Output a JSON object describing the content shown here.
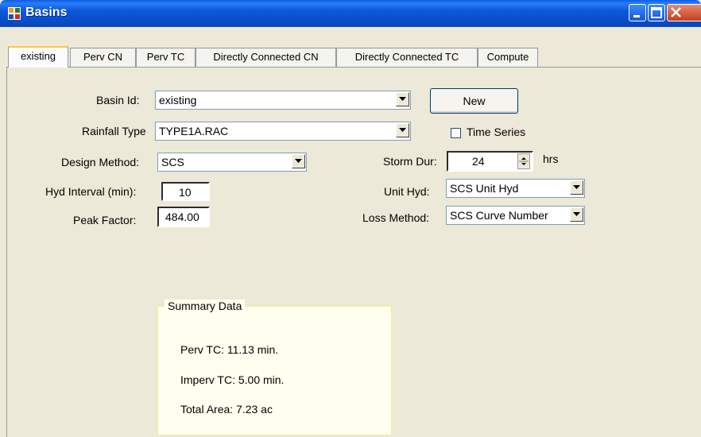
{
  "window": {
    "title": "Basins"
  },
  "tabs": [
    {
      "label": "existing"
    },
    {
      "label": "Perv CN"
    },
    {
      "label": "Perv TC"
    },
    {
      "label": "Directly Connected CN"
    },
    {
      "label": "Directly Connected TC"
    },
    {
      "label": "Compute"
    }
  ],
  "form": {
    "basin_id": {
      "label": "Basin Id:",
      "value": "existing"
    },
    "rainfall_type": {
      "label": "Rainfall Type",
      "value": "TYPE1A.RAC"
    },
    "design_method": {
      "label": "Design Method:",
      "value": "SCS"
    },
    "hyd_interval": {
      "label": "Hyd Interval (min):",
      "value": "10"
    },
    "peak_factor": {
      "label": "Peak Factor:",
      "value": "484.00"
    },
    "new_button": "New",
    "time_series": {
      "label": "Time Series",
      "checked": false
    },
    "storm_dur": {
      "label": "Storm Dur:",
      "value": "24",
      "unit": "hrs"
    },
    "unit_hyd": {
      "label": "Unit Hyd:",
      "value": "SCS Unit Hyd"
    },
    "loss_method": {
      "label": "Loss Method:",
      "value": "SCS Curve Number"
    }
  },
  "summary": {
    "title": "Summary Data",
    "perv_tc": "Perv TC: 11.13 min.",
    "imperv_tc": "Imperv TC: 5.00 min.",
    "total_area": "Total Area: 7.23 ac"
  },
  "colors": {
    "titlebar": "#0a4cc6",
    "window_bg": "#ece9d8",
    "summary_border": "#f3f08a",
    "active_tab_accent": "#ffc83c"
  }
}
